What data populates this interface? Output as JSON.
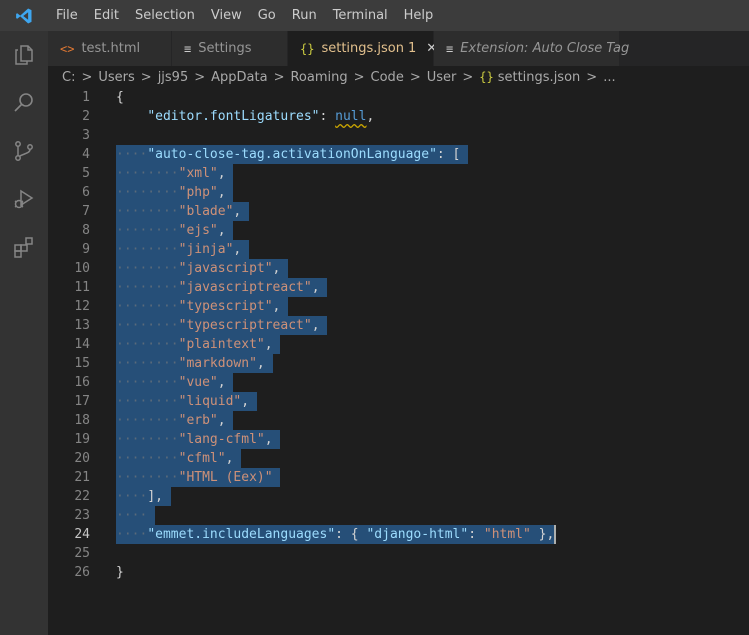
{
  "menu": [
    "File",
    "Edit",
    "Selection",
    "View",
    "Go",
    "Run",
    "Terminal",
    "Help"
  ],
  "tabs": [
    {
      "icon": "<>",
      "label": "test.html"
    },
    {
      "icon": "≡",
      "label": "Settings"
    },
    {
      "icon": "{}",
      "label": "settings.json",
      "badge": "1",
      "close": "✕"
    },
    {
      "icon": "≡",
      "label": "Extension: Auto Close Tag"
    }
  ],
  "breadcrumb": [
    "C:",
    "Users",
    "jjs95",
    "AppData",
    "Roaming",
    "Code",
    "User",
    "settings.json",
    "..."
  ],
  "colors": {
    "selection": "#264f78",
    "key": "#9cdcfe",
    "string": "#ce9178",
    "keyword": "#569cd6",
    "warning": "#cca700",
    "modified": "#e2c08d"
  },
  "editor": {
    "current_line": 24,
    "lines": [
      {
        "n": "1"
      },
      {
        "n": "2"
      },
      {
        "n": "3"
      },
      {
        "n": "4"
      },
      {
        "n": "5"
      },
      {
        "n": "6"
      },
      {
        "n": "7"
      },
      {
        "n": "8"
      },
      {
        "n": "9"
      },
      {
        "n": "10"
      },
      {
        "n": "11"
      },
      {
        "n": "12"
      },
      {
        "n": "13"
      },
      {
        "n": "14"
      },
      {
        "n": "15"
      },
      {
        "n": "16"
      },
      {
        "n": "17"
      },
      {
        "n": "18"
      },
      {
        "n": "19"
      },
      {
        "n": "20"
      },
      {
        "n": "21"
      },
      {
        "n": "22"
      },
      {
        "n": "23"
      },
      {
        "n": "24"
      },
      {
        "n": "25"
      },
      {
        "n": "26"
      }
    ],
    "code": {
      "l1": "{",
      "l2_key": "\"editor.fontLigatures\"",
      "l2_colon": ": ",
      "l2_val": "null",
      "l2_end": ",",
      "l4_key": "\"auto-close-tag.activationOnLanguage\"",
      "l4_rest": ": [",
      "langs": [
        "\"xml\"",
        "\"php\"",
        "\"blade\"",
        "\"ejs\"",
        "\"jinja\"",
        "\"javascript\"",
        "\"javascriptreact\"",
        "\"typescript\"",
        "\"typescriptreact\"",
        "\"plaintext\"",
        "\"markdown\"",
        "\"vue\"",
        "\"liquid\"",
        "\"erb\"",
        "\"lang-cfml\"",
        "\"cfml\"",
        "\"HTML (Eex)\""
      ],
      "l22": "],",
      "l24_key": "\"emmet.includeLanguages\"",
      "l24_a": ": { ",
      "l24_k2": "\"django-html\"",
      "l24_b": ": ",
      "l24_v2": "\"html\"",
      "l24_c": " },",
      "l26": "}"
    }
  }
}
